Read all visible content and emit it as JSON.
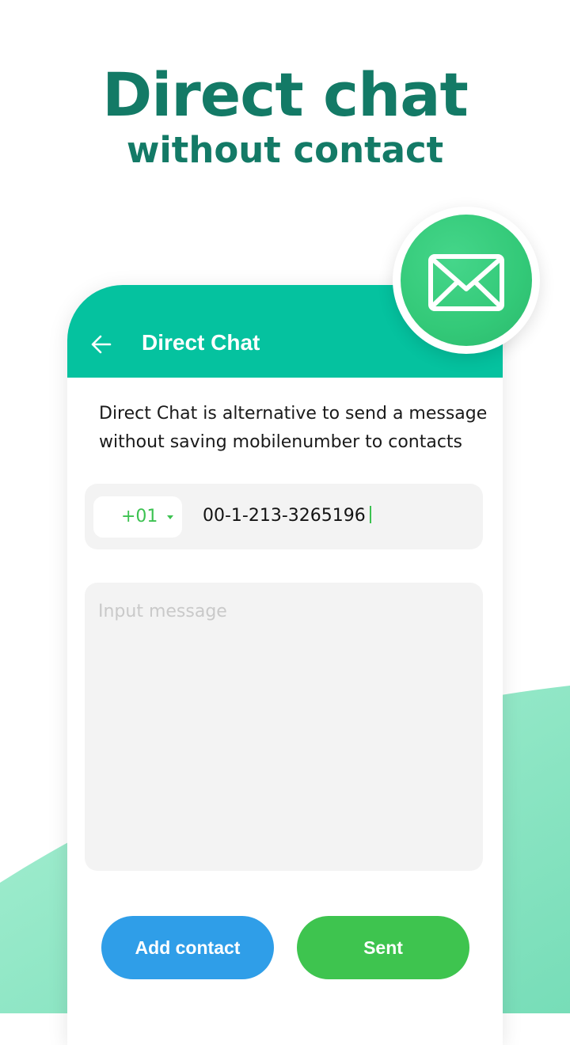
{
  "headline": {
    "title": "Direct chat",
    "subtitle": "without contact"
  },
  "appbar": {
    "title": "Direct Chat",
    "back_icon": "arrow-left-icon",
    "color": "#05c29f"
  },
  "description": "Direct Chat is alternative to send a message without saving mobilenumber to contacts",
  "phone": {
    "country_code": "+01",
    "number": "00-1-213-3265196",
    "dropdown_icon": "chevron-down-icon"
  },
  "message": {
    "placeholder": "Input message",
    "value": ""
  },
  "buttons": {
    "add_contact": "Add contact",
    "sent": "Sent"
  },
  "badge": {
    "icon": "envelope-icon"
  },
  "colors": {
    "headline": "#137a66",
    "accent_green": "#3ec44f",
    "accent_blue": "#2f9ee8",
    "wave_light": "#a8f0d2",
    "wave_dark": "#7ee0bc"
  }
}
